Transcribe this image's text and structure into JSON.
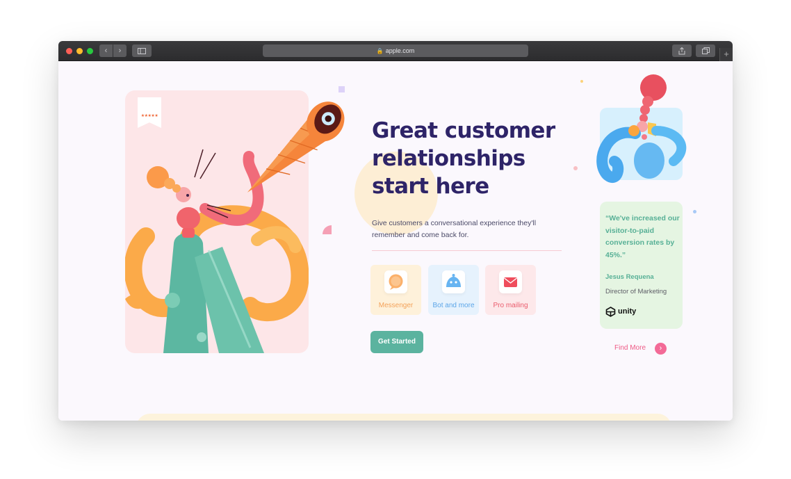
{
  "browser": {
    "url": "apple.com",
    "colors": {
      "chrome": "#2c2c2e",
      "close": "#fe5f57",
      "minimize": "#febc2e",
      "zoom": "#28c840"
    }
  },
  "hero": {
    "rating": "★★★★★",
    "headline_lines": [
      "Great customer",
      "relationships",
      "start here"
    ],
    "subtext": "Give customers a conversational experience they'll remember and come back for.",
    "colors": {
      "headline": "#2e2468",
      "card_bg": "#fde6e8"
    }
  },
  "features": [
    {
      "label": "Messenger",
      "icon": "chat-bubble-icon",
      "color": "#f3a25a"
    },
    {
      "label": "Bot and more",
      "icon": "bot-icon",
      "color": "#5ba5e8"
    },
    {
      "label": "Pro mailing",
      "icon": "mail-icon",
      "color": "#ea5b6c"
    }
  ],
  "cta": {
    "label": "Get Started",
    "color": "#5bb39f"
  },
  "testimonial": {
    "quote": "“We've increased our visitor-to-paid conversion rates by 45%.”",
    "author": "Jesus Requena",
    "role": "Director of  Marketing",
    "company": "unity",
    "color": "#57b096"
  },
  "find_more": {
    "label": "Find More",
    "icon": "arrow-right-icon",
    "color": "#ee5a86"
  }
}
